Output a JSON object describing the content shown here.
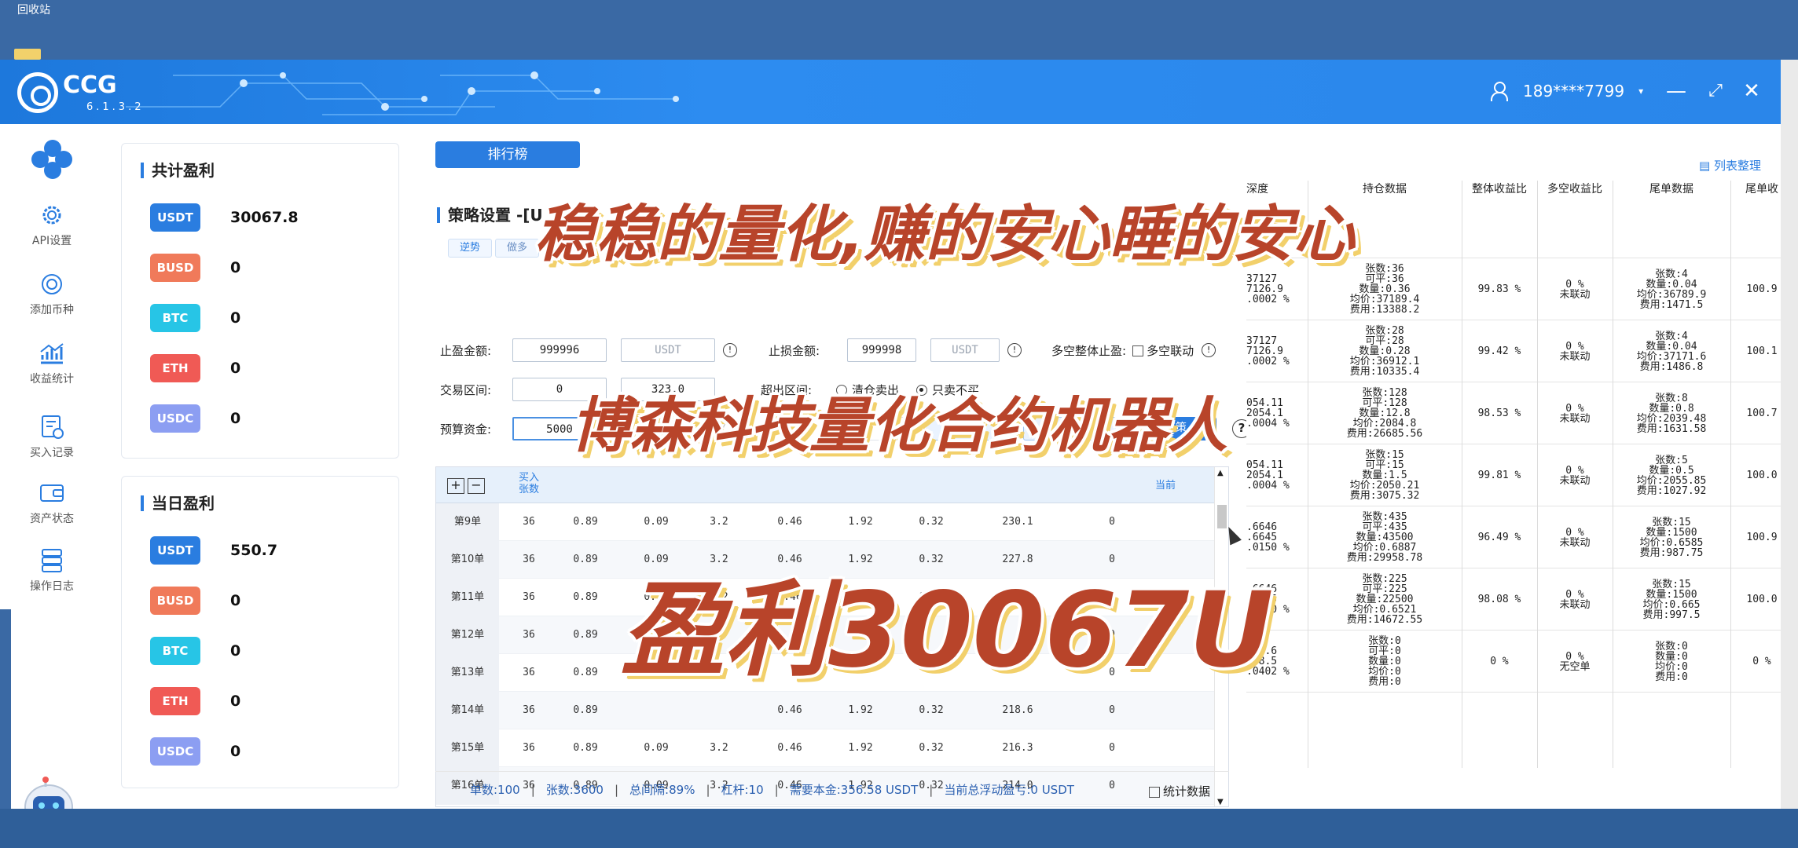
{
  "desktop": {
    "recycle_bin_label": "回收站"
  },
  "app": {
    "name": "CCG",
    "version": "6.1.3.2",
    "user": "189****7799"
  },
  "sidebar": {
    "items": [
      {
        "label": "API设置",
        "icon": "gear-icon"
      },
      {
        "label": "添加币种",
        "icon": "add-coin-icon"
      },
      {
        "label": "收益统计",
        "icon": "chart-icon"
      },
      {
        "label": "买入记录",
        "icon": "record-icon"
      },
      {
        "label": "资产状态",
        "icon": "wallet-icon"
      },
      {
        "label": "操作日志",
        "icon": "log-icon"
      }
    ]
  },
  "total_profit": {
    "title": "共计盈利",
    "rows": [
      {
        "coin": "USDT",
        "value": "30067.8",
        "color": "#2a7de0"
      },
      {
        "coin": "BUSD",
        "value": "0",
        "color": "#f07a5a"
      },
      {
        "coin": "BTC",
        "value": "0",
        "color": "#27c5e6"
      },
      {
        "coin": "ETH",
        "value": "0",
        "color": "#f05a55"
      },
      {
        "coin": "USDC",
        "value": "0",
        "color": "#8c9ef2"
      }
    ]
  },
  "daily_profit": {
    "title": "当日盈利",
    "rows": [
      {
        "coin": "USDT",
        "value": "550.7",
        "color": "#2a7de0"
      },
      {
        "coin": "BUSD",
        "value": "0",
        "color": "#f07a5a"
      },
      {
        "coin": "BTC",
        "value": "0",
        "color": "#27c5e6"
      },
      {
        "coin": "ETH",
        "value": "0",
        "color": "#f05a55"
      },
      {
        "coin": "USDC",
        "value": "0",
        "color": "#8c9ef2"
      }
    ]
  },
  "main": {
    "rank_button": "排行榜",
    "section_title": "策略设置 -[U",
    "tabs": [
      "逆势",
      "做多"
    ],
    "form": {
      "take_profit_label": "止盈金额:",
      "take_profit_value": "999996",
      "take_profit_unit": "USDT",
      "stop_loss_label": "止损金额:",
      "stop_loss_value": "999998",
      "stop_loss_unit": "USDT",
      "longshort_label": "多空整体止盈:",
      "longshort_check": "多空联动",
      "range_label": "交易区间:",
      "range_min": "0",
      "range_max": "323.0",
      "exceed_label": "超出区间:",
      "exceed_opt1": "清仓卖出",
      "exceed_opt2": "只卖不买",
      "budget_label": "预算资金:",
      "budget_value": "5000",
      "save_button": "保存策",
      "help": "?"
    },
    "table": {
      "headers": [
        "买入\n张数",
        "",
        "",
        "",
        "",
        "",
        "",
        "",
        "当前"
      ],
      "rows": [
        [
          "第9单",
          "36",
          "0.89",
          "0.09",
          "3.2",
          "0.46",
          "1.92",
          "0.32",
          "230.1",
          "0"
        ],
        [
          "第10单",
          "36",
          "0.89",
          "0.09",
          "3.2",
          "0.46",
          "1.92",
          "0.32",
          "227.8",
          "0"
        ],
        [
          "第11单",
          "36",
          "0.89",
          "0.09",
          "3.2",
          "0.46",
          "1.92",
          "0.32",
          "225.5",
          "0"
        ],
        [
          "第12单",
          "36",
          "0.89",
          "",
          "",
          "",
          "",
          "",
          "",
          "0"
        ],
        [
          "第13单",
          "36",
          "0.89",
          "",
          "",
          "",
          "",
          "",
          "",
          "0"
        ],
        [
          "第14单",
          "36",
          "0.89",
          "",
          "",
          "0.46",
          "1.92",
          "0.32",
          "218.6",
          "0"
        ],
        [
          "第15单",
          "36",
          "0.89",
          "0.09",
          "3.2",
          "0.46",
          "1.92",
          "0.32",
          "216.3",
          "0"
        ],
        [
          "第16单",
          "36",
          "0.89",
          "0.09",
          "3.2",
          "0.46",
          "1.92",
          "0.32",
          "214.0",
          "0"
        ]
      ]
    },
    "stats": {
      "orders": "单数:100",
      "contracts": "张数:3600",
      "interval": "总间隔:89%",
      "leverage": "杠杆:10",
      "principal": "需要本金:356.58 USDT",
      "floating": "当前总浮动盈亏:0 USDT",
      "stat_check": "统计数据"
    }
  },
  "right_panel": {
    "list_link": "列表整理",
    "headers": [
      "深度",
      "持仓数据",
      "整体收益比",
      "多空收益比",
      "尾单数据",
      "尾单收"
    ],
    "rows": [
      {
        "depth": [
          "",
          "",
          ""
        ],
        "pos": [],
        "overall": "",
        "ls": [],
        "tail": [],
        "tailp": ""
      },
      {
        "depth": [
          "37127",
          "7126.9",
          ".0002 %"
        ],
        "pos": [
          "张数:36",
          "可平:36",
          "数量:0.36",
          "均价:37189.4",
          "费用:13388.2"
        ],
        "overall": "99.83 %",
        "ls": [
          "0 %",
          "未联动"
        ],
        "tail": [
          "张数:4",
          "数量:0.04",
          "均价:36789.9",
          "费用:1471.5"
        ],
        "tailp": "100.9"
      },
      {
        "depth": [
          "37127",
          "7126.9",
          ".0002 %"
        ],
        "pos": [
          "张数:28",
          "可平:28",
          "数量:0.28",
          "均价:36912.1",
          "费用:10335.4"
        ],
        "overall": "99.42 %",
        "ls": [
          "0 %",
          "未联动"
        ],
        "tail": [
          "张数:4",
          "数量:0.04",
          "均价:37171.6",
          "费用:1486.8"
        ],
        "tailp": "100.1"
      },
      {
        "depth": [
          "054.11",
          "2054.1",
          ".0004 %"
        ],
        "pos": [
          "张数:128",
          "可平:128",
          "数量:12.8",
          "均价:2084.8",
          "费用:26685.56"
        ],
        "overall": "98.53 %",
        "ls": [
          "0 %",
          "未联动"
        ],
        "tail": [
          "张数:8",
          "数量:0.8",
          "均价:2039.48",
          "费用:1631.58"
        ],
        "tailp": "100.7"
      },
      {
        "depth": [
          "054.11",
          "2054.1",
          ".0004 %"
        ],
        "pos": [
          "张数:15",
          "可平:15",
          "数量:1.5",
          "均价:2050.21",
          "费用:3075.32"
        ],
        "overall": "99.81 %",
        "ls": [
          "0 %",
          "未联动"
        ],
        "tail": [
          "张数:5",
          "数量:0.5",
          "均价:2055.85",
          "费用:1027.92"
        ],
        "tailp": "100.0"
      },
      {
        "depth": [
          ".6646",
          ".6645",
          ".0150 %"
        ],
        "pos": [
          "张数:435",
          "可平:435",
          "数量:43500",
          "均价:0.6887",
          "费用:29958.78"
        ],
        "overall": "96.49 %",
        "ls": [
          "0 %",
          "未联动"
        ],
        "tail": [
          "张数:15",
          "数量:1500",
          "均价:0.6585",
          "费用:987.75"
        ],
        "tailp": "100.9"
      },
      {
        "depth": [
          ".6646",
          ".6645",
          ".0150 %"
        ],
        "pos": [
          "张数:225",
          "可平:225",
          "数量:22500",
          "均价:0.6521",
          "费用:14672.55"
        ],
        "overall": "98.08 %",
        "ls": [
          "0 %",
          "未联动"
        ],
        "tail": [
          "张数:15",
          "数量:1500",
          "均价:0.665",
          "费用:997.5"
        ],
        "tailp": "100.0"
      },
      {
        "depth": [
          "248.6",
          "248.5",
          ".0402 %"
        ],
        "pos": [
          "张数:0",
          "可平:0",
          "数量:0",
          "均价:0",
          "费用:0"
        ],
        "overall": "0 %",
        "ls": [
          "0 %",
          "无空单"
        ],
        "tail": [
          "张数:0",
          "数量:0",
          "均价:0",
          "费用:0"
        ],
        "tailp": "0 %"
      }
    ]
  },
  "overlay": {
    "line1": "稳稳的量化,赚的安心睡的安心",
    "line2": "博森科技量化合约机器人",
    "line3": "盈利30067U"
  }
}
